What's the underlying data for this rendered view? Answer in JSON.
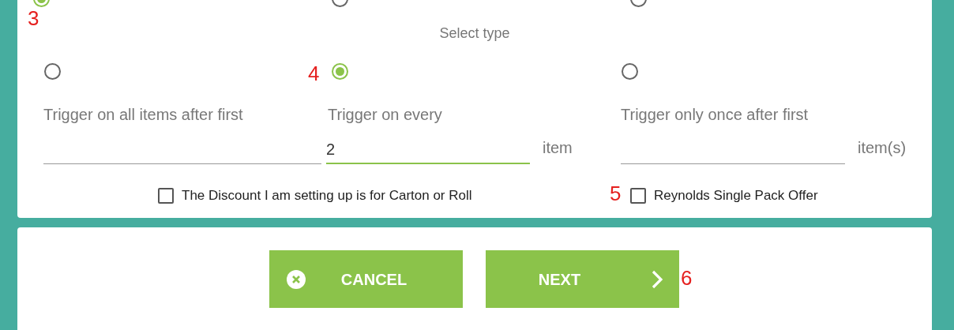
{
  "funding_options": [
    {
      "selected": true
    },
    {
      "selected": false
    },
    {
      "selected": false
    }
  ],
  "select_type_label": "Select type",
  "trigger_options": [
    {
      "label": "Trigger on all items after first",
      "selected": false
    },
    {
      "label": "Trigger on every",
      "selected": true,
      "value": "2",
      "unit": "item"
    },
    {
      "label": "Trigger only once after first",
      "selected": false,
      "unit": "item(s)"
    }
  ],
  "checkboxes": [
    {
      "label": "The Discount I am setting up is for Carton or Roll",
      "checked": false
    },
    {
      "label": "Reynolds Single Pack Offer",
      "checked": false
    }
  ],
  "buttons": [
    {
      "kind": "cancel",
      "label": "CANCEL"
    },
    {
      "kind": "next",
      "label": "NEXT"
    }
  ],
  "annotations": [
    "3",
    "4",
    "5",
    "6"
  ]
}
